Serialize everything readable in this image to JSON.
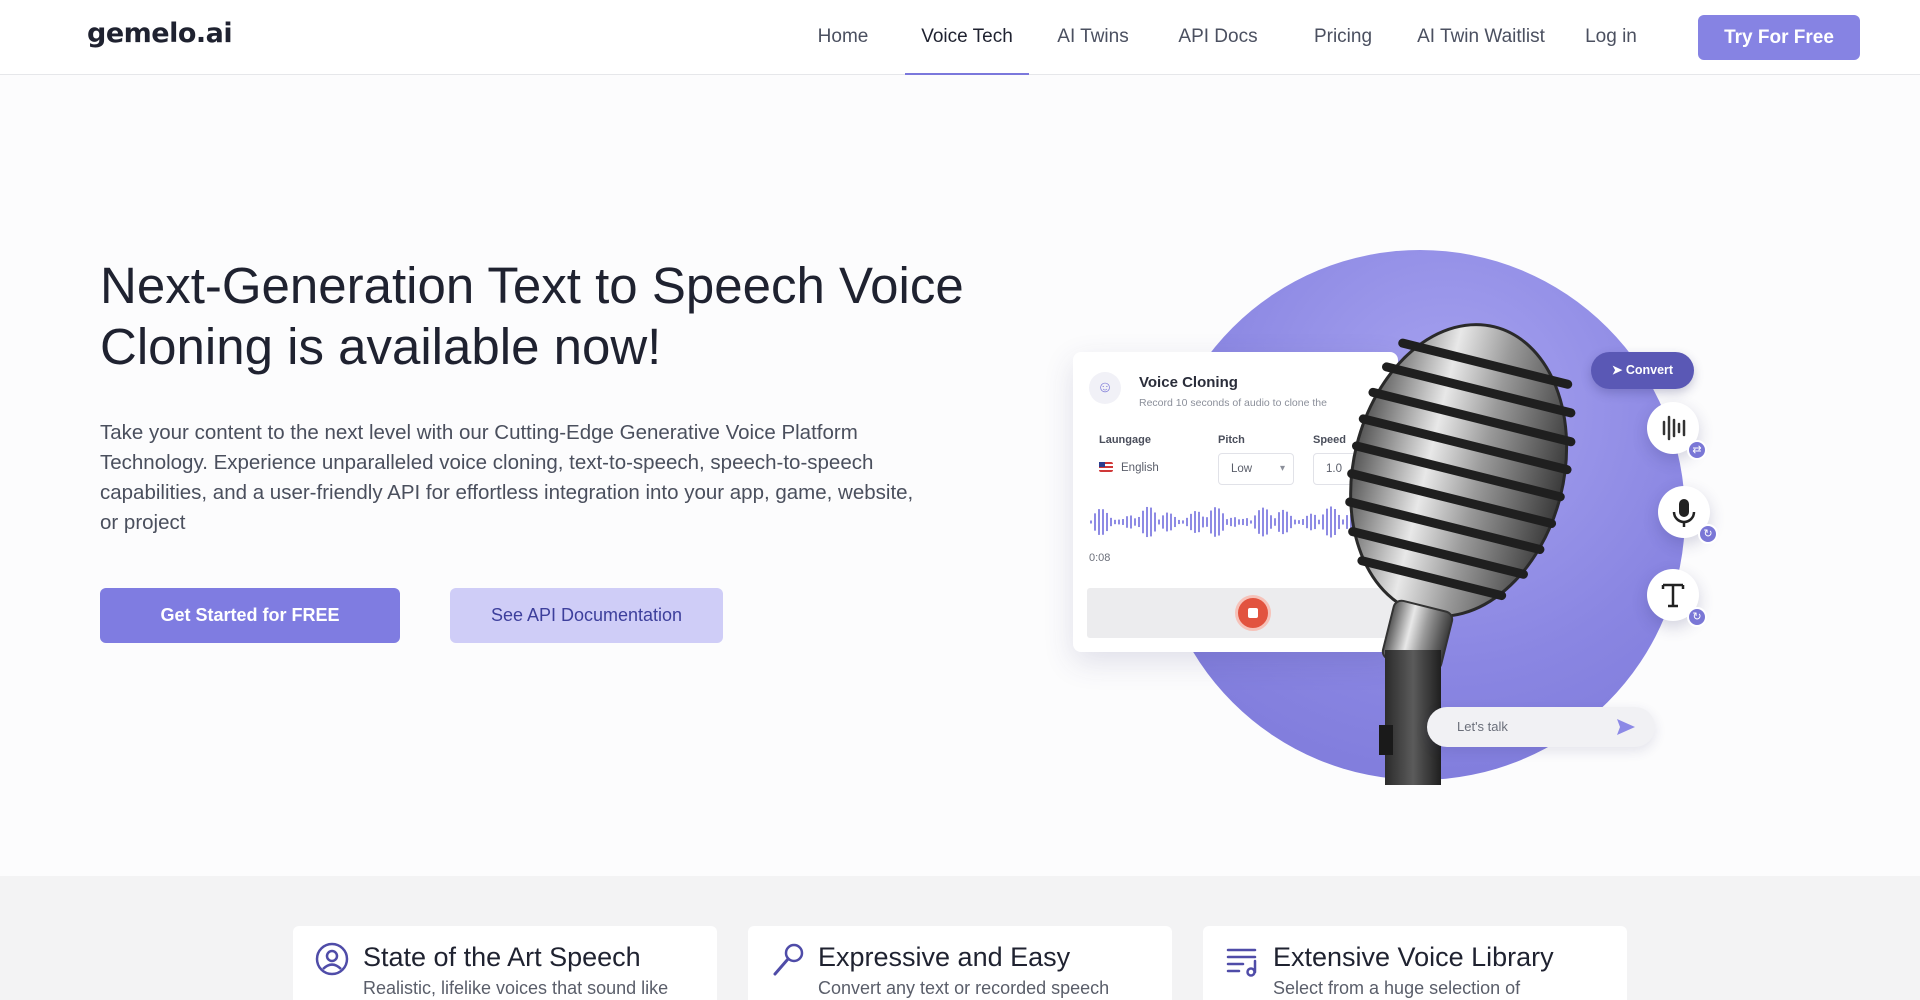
{
  "nav": {
    "logo": "gemelo.ai",
    "links": [
      "Home",
      "Voice Tech",
      "AI Twins",
      "API Docs",
      "Pricing",
      "AI Twin Waitlist",
      "Log in"
    ],
    "active": "Voice Tech",
    "cta": "Try For Free"
  },
  "hero": {
    "title": "Next-Generation Text to Speech Voice Cloning is available now!",
    "description": "Take your content to the next level with our Cutting-Edge Generative Voice Platform Technology. Experience unparalleled voice cloning, text-to-speech, speech-to-speech capabilities, and a user-friendly API for effortless integration into your app, game, website, or project",
    "primary_button": "Get Started for FREE",
    "secondary_button": "See API Documentation"
  },
  "illustration": {
    "card_title": "Voice Cloning",
    "card_subtitle": "Record 10 seconds of audio to clone the",
    "language_label": "Laungage",
    "language_value": "English",
    "pitch_label": "Pitch",
    "pitch_value": "Low",
    "speed_label": "Speed",
    "speed_value": "1.0",
    "time": "0:08",
    "convert_label": "Convert",
    "chat_placeholder": "Let's talk"
  },
  "features": [
    {
      "icon": "user-circle-icon",
      "title": "State of the Art Speech",
      "desc": "Realistic, lifelike voices that sound like"
    },
    {
      "icon": "microphone-icon",
      "title": "Expressive and Easy",
      "desc": "Convert any text or recorded speech"
    },
    {
      "icon": "playlist-music-icon",
      "title": "Extensive Voice Library",
      "desc": "Select from a huge selection of"
    }
  ],
  "colors": {
    "accent": "#8683e3",
    "accent_light": "#cfcdf7",
    "record": "#e2533f"
  }
}
